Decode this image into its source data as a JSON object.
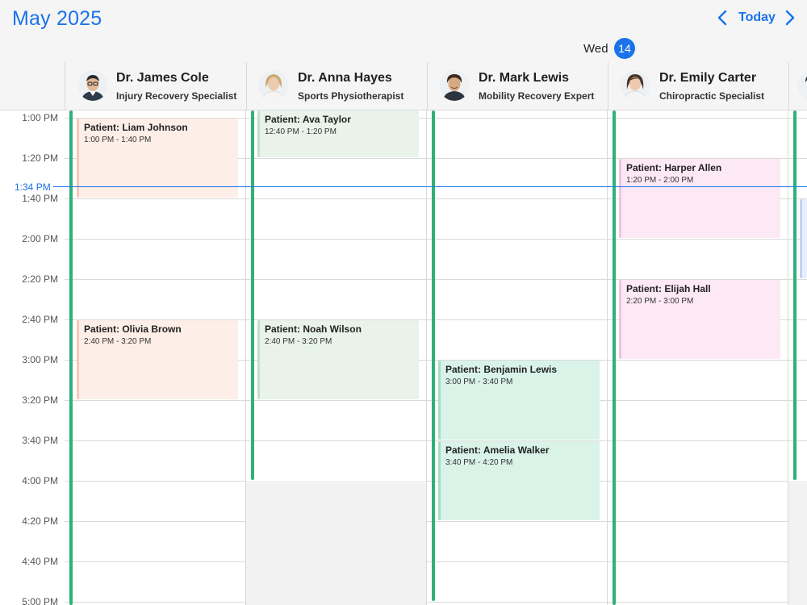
{
  "header": {
    "title": "May 2025",
    "today_label": "Today",
    "prev_icon": "chevron-left-icon",
    "next_icon": "chevron-right-icon",
    "day_label": "Wed",
    "day_number": "14",
    "accent_color": "#1a73e8"
  },
  "resources": [
    {
      "name": "Dr. James Cole",
      "specialty": "Injury Recovery Specialist"
    },
    {
      "name": "Dr. Anna Hayes",
      "specialty": "Sports Physiotherapist"
    },
    {
      "name": "Dr. Mark Lewis",
      "specialty": "Mobility Recovery Expert"
    },
    {
      "name": "Dr. Emily Carter",
      "specialty": "Chiropractic Specialist"
    }
  ],
  "time_slots": [
    "1:00 PM",
    "1:20 PM",
    "1:40 PM",
    "2:00 PM",
    "2:20 PM",
    "2:40 PM",
    "3:00 PM",
    "3:20 PM",
    "3:40 PM",
    "4:00 PM",
    "4:20 PM",
    "4:40 PM",
    "5:00 PM"
  ],
  "current_time": "1:34 PM",
  "appointments": [
    {
      "resource": 0,
      "title": "Patient: Liam Johnson",
      "time": "1:00 PM - 1:40 PM",
      "color": "#fdeee8",
      "border": "#f6c9b8"
    },
    {
      "resource": 0,
      "title": "Patient: Olivia Brown",
      "time": "2:40 PM - 3:20 PM",
      "color": "#fdeee8",
      "border": "#f6c9b8"
    },
    {
      "resource": 1,
      "title": "Patient: Ava Taylor",
      "time": "12:40 PM - 1:20 PM",
      "color": "#e9f3ea",
      "border": "#c5dfc8"
    },
    {
      "resource": 1,
      "title": "Patient: Noah Wilson",
      "time": "2:40 PM - 3:20 PM",
      "color": "#e9f3ea",
      "border": "#c5dfc8"
    },
    {
      "resource": 2,
      "title": "Patient: Benjamin Lewis",
      "time": "3:00 PM - 3:40 PM",
      "color": "#d9f3e9",
      "border": "#a8dcc6"
    },
    {
      "resource": 2,
      "title": "Patient: Amelia Walker",
      "time": "3:40 PM - 4:20 PM",
      "color": "#d9f3e9",
      "border": "#a8dcc6"
    },
    {
      "resource": 3,
      "title": "Patient: Harper Allen",
      "time": "1:20 PM - 2:00 PM",
      "color": "#fde9f5",
      "border": "#f3c3df"
    },
    {
      "resource": 3,
      "title": "Patient: Elijah Hall",
      "time": "2:20 PM - 3:00 PM",
      "color": "#fde9f5",
      "border": "#f3c3df"
    }
  ],
  "working_hours_color": "#2fb07a"
}
